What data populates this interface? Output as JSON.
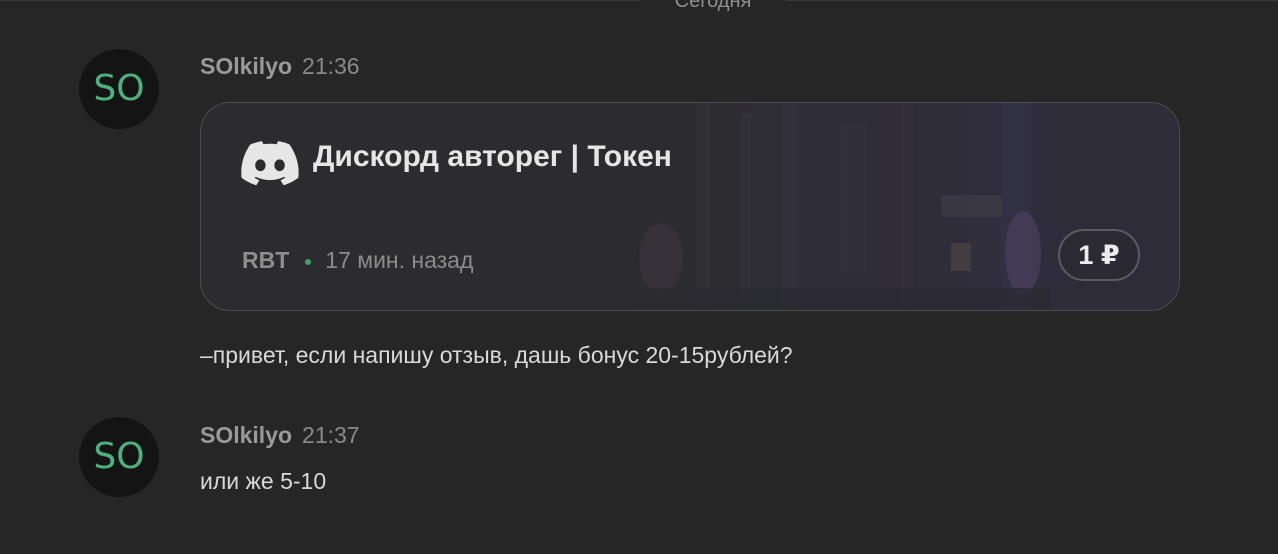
{
  "day_divider": "Сегодня",
  "messages": [
    {
      "avatar_initials": "SO",
      "author": "SOlkilyo",
      "time": "21:36",
      "card": {
        "icon": "discord-icon",
        "title": "Дискорд авторег | Токен",
        "seller": "RBT",
        "posted": "17 мин. назад",
        "price": "1 ₽"
      },
      "text": "–привет, если напишу отзыв, дашь бонус 20-15рублей?"
    },
    {
      "avatar_initials": "SO",
      "author": "SOlkilyo",
      "time": "21:37",
      "text": "или же 5-10"
    }
  ],
  "colors": {
    "background": "#262626",
    "avatar_text": "#4fb07d",
    "online_dot": "#3fa46a"
  }
}
